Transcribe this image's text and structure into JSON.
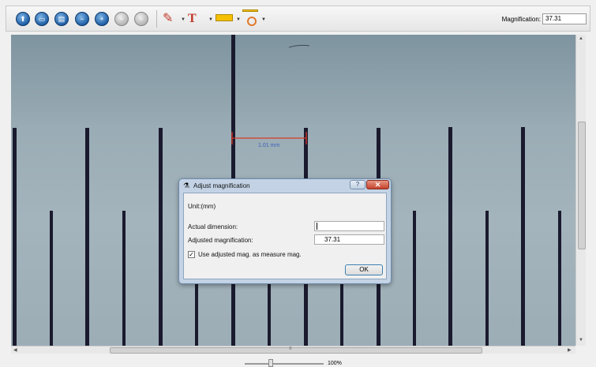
{
  "toolbar": {
    "buttons": [
      {
        "icon": "capture-icon",
        "glyph": "⬆"
      },
      {
        "icon": "open-icon",
        "glyph": "▭"
      },
      {
        "icon": "print-icon",
        "glyph": "▤"
      },
      {
        "icon": "zoom-out-icon",
        "glyph": "−"
      },
      {
        "icon": "zoom-in-icon",
        "glyph": "+"
      },
      {
        "icon": "disabled-icon",
        "glyph": "−"
      },
      {
        "icon": "disabled-icon-2",
        "glyph": "−"
      }
    ],
    "magnification_label": "Magnification:",
    "magnification_value": "37.31"
  },
  "image": {
    "measurement_label": "1.01 mm",
    "accent_color": "#d8382a",
    "label_color": "#3d63b8"
  },
  "zoom": {
    "percent": "100%"
  },
  "dialog": {
    "title": "Adjust magnification",
    "help": "?",
    "close": "✕",
    "unit": "Unit:(mm)",
    "actual_dimension_label": "Actual dimension:",
    "actual_dimension_value": "",
    "adjusted_mag_label": "Adjusted magnification:",
    "adjusted_mag_value": "37.31",
    "checkbox_label": "Use adjusted mag. as measure mag.",
    "checkbox_checked": "✓",
    "ok": "OK"
  }
}
